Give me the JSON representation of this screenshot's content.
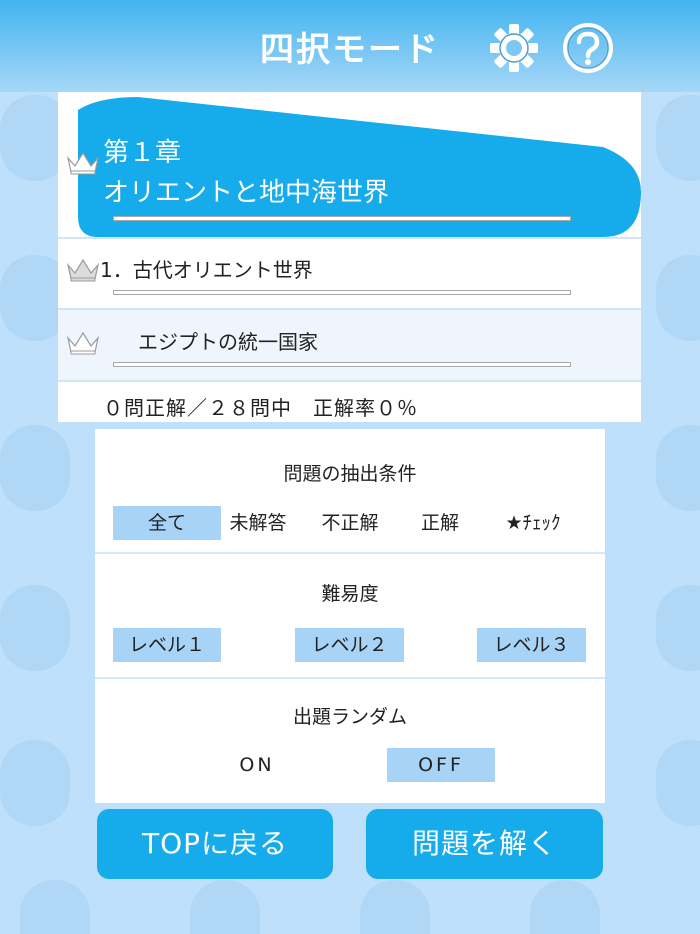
{
  "header": {
    "title": "四択モード"
  },
  "chapter": {
    "label": "第１章",
    "title": "オリエントと地中海世界",
    "progress": 0
  },
  "section": {
    "label": "1．古代オリエント世界",
    "progress": 0
  },
  "subsection": {
    "label": "エジプトの統一国家",
    "progress": 0
  },
  "stats": {
    "text": "０問正解／２８問中　正解率０％"
  },
  "filter": {
    "heading": "問題の抽出条件",
    "options": [
      "全て",
      "未解答",
      "不正解",
      "正解",
      "★ﾁｪｯｸ"
    ],
    "selected": "全て"
  },
  "difficulty": {
    "heading": "難易度",
    "options": [
      "レベル１",
      "レベル２",
      "レベル３"
    ],
    "selected": [
      "レベル１",
      "レベル２",
      "レベル３"
    ]
  },
  "random": {
    "heading": "出題ランダム",
    "options": [
      "ON",
      "OFF"
    ],
    "selected": "OFF"
  },
  "buttons": {
    "top": "TOPに戻る",
    "solve": "問題を解く"
  },
  "icons": {
    "settings": "gear-icon",
    "help": "help-icon",
    "crown": "crown-icon"
  },
  "colors": {
    "accent": "#16acec",
    "selected": "#a6d3f6",
    "header_top": "#42b4f0",
    "background": "#bfe0fb"
  }
}
